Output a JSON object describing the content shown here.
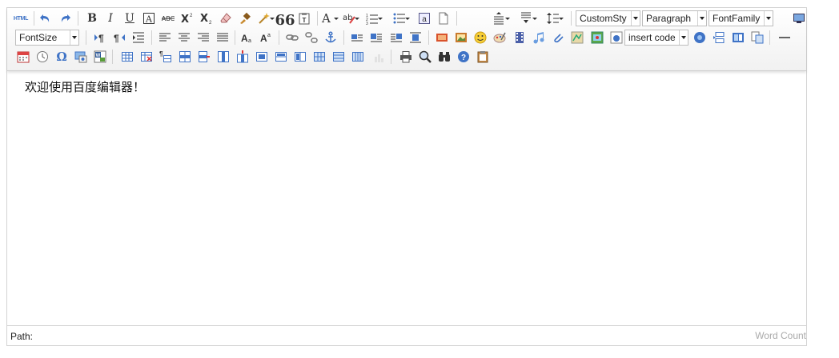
{
  "toolbar": {
    "html_label": "HTML",
    "combos": {
      "custom_style": "CustomSty",
      "paragraph": "Paragraph",
      "font_family": "FontFamily",
      "font_size": "FontSize",
      "insert_code": "insert code"
    },
    "icons": [
      "source-html-icon",
      "undo-icon",
      "redo-icon",
      "bold-icon",
      "italic-icon",
      "underline-icon",
      "font-border-icon",
      "strikethrough-icon",
      "superscript-icon",
      "subscript-icon",
      "eraser-icon",
      "format-brush-icon",
      "auto-typeset-icon",
      "blockquote-icon",
      "paste-plain-icon",
      "font-color-icon",
      "highlight-color-icon",
      "ordered-list-icon",
      "unordered-list-icon",
      "select-all-icon",
      "clear-doc-icon",
      "row-spacing-top-icon",
      "row-spacing-bottom-icon",
      "line-height-icon",
      "fullscreen-icon",
      "ltr-icon",
      "rtl-icon",
      "indent-icon",
      "justify-left-icon",
      "justify-center-icon",
      "justify-right-icon",
      "justify-full-icon",
      "touppercase-icon",
      "tolowercase-icon",
      "link-icon",
      "unlink-icon",
      "anchor-icon",
      "image-none-icon",
      "image-left-icon",
      "image-right-icon",
      "image-center-icon",
      "simple-upload-icon",
      "insert-image-icon",
      "emotion-icon",
      "scrawl-icon",
      "insert-video-icon",
      "music-icon",
      "attachment-icon",
      "map-icon",
      "gmap-icon",
      "insert-frame-icon",
      "webapp-icon",
      "page-break-icon",
      "background-icon",
      "template-icon",
      "horizontal-rule-icon",
      "date-icon",
      "time-icon",
      "special-chars-icon",
      "snapscreen-icon",
      "word-image-icon",
      "insert-table-icon",
      "delete-table-icon",
      "insert-paragraph-before-table-icon",
      "insert-row-icon",
      "delete-row-icon",
      "insert-col-icon",
      "delete-col-icon",
      "merge-cells-icon",
      "merge-right-icon",
      "merge-down-icon",
      "split-to-cells-icon",
      "split-to-rows-icon",
      "split-to-cols-icon",
      "charts-icon",
      "print-icon",
      "preview-icon",
      "search-replace-icon",
      "help-icon",
      "drafts-icon"
    ]
  },
  "content": {
    "text": "欢迎使用百度编辑器！"
  },
  "status": {
    "path_label": "Path:",
    "word_count_label": "Word Count"
  },
  "colors": {
    "toolbar_bg": "#f1f1f1",
    "border": "#d4d4d4",
    "word_count": "#aaaaaa",
    "icon_blue": "#3f73c6"
  }
}
